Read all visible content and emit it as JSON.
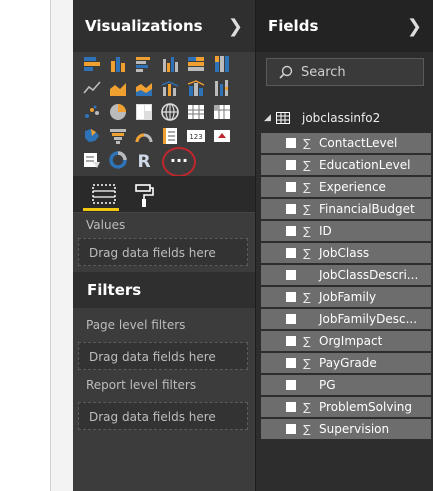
{
  "visualizations": {
    "title": "Visualizations",
    "chevron_icon": "chevron-right-icon",
    "icons": [
      [
        "stacked-bar-icon",
        "stacked-column-icon",
        "clustered-bar-icon",
        "clustered-column-icon",
        "100-stacked-bar-icon",
        "100-stacked-column-icon"
      ],
      [
        "line-chart-icon",
        "area-chart-icon",
        "stacked-area-icon",
        "line-clustered-column-icon",
        "line-stacked-column-icon",
        "ribbon-chart-icon"
      ],
      [
        "scatter-chart-icon",
        "pie-chart-icon",
        "treemap-icon",
        "map-icon",
        "table-icon",
        "matrix-icon"
      ],
      [
        "filled-map-icon",
        "funnel-icon",
        "gauge-icon",
        "multirow-card-icon",
        "card-icon",
        "kpi-icon"
      ],
      [
        "slicer-icon",
        "donut-chart-icon",
        "r-visual-icon",
        "more-visuals-icon"
      ]
    ],
    "more_label": "···",
    "r_label": "R",
    "card_label": "123",
    "values_label": "Values",
    "drag_label": "Drag data fields here"
  },
  "filters": {
    "title": "Filters",
    "page_level": "Page level filters",
    "report_level": "Report level filters",
    "drag_label": "Drag data fields here"
  },
  "fields": {
    "title": "Fields",
    "search_placeholder": "Search",
    "table_name": "jobclassinfo2",
    "items": [
      {
        "label": "ContactLevel",
        "sigma": true
      },
      {
        "label": "EducationLevel",
        "sigma": true
      },
      {
        "label": "Experience",
        "sigma": true
      },
      {
        "label": "FinancialBudget",
        "sigma": true
      },
      {
        "label": "ID",
        "sigma": true
      },
      {
        "label": "JobClass",
        "sigma": true
      },
      {
        "label": "JobClassDescri...",
        "sigma": false
      },
      {
        "label": "JobFamily",
        "sigma": true
      },
      {
        "label": "JobFamilyDesc...",
        "sigma": false
      },
      {
        "label": "OrgImpact",
        "sigma": true
      },
      {
        "label": "PayGrade",
        "sigma": true
      },
      {
        "label": "PG",
        "sigma": false
      },
      {
        "label": "ProblemSolving",
        "sigma": true
      },
      {
        "label": "Supervision",
        "sigma": true
      }
    ]
  },
  "colors": {
    "accent_yellow": "#f2c811",
    "annotation_red": "#c0272d",
    "pane_dark": "#3c3c3c",
    "field_bg": "#6d6d6d"
  }
}
